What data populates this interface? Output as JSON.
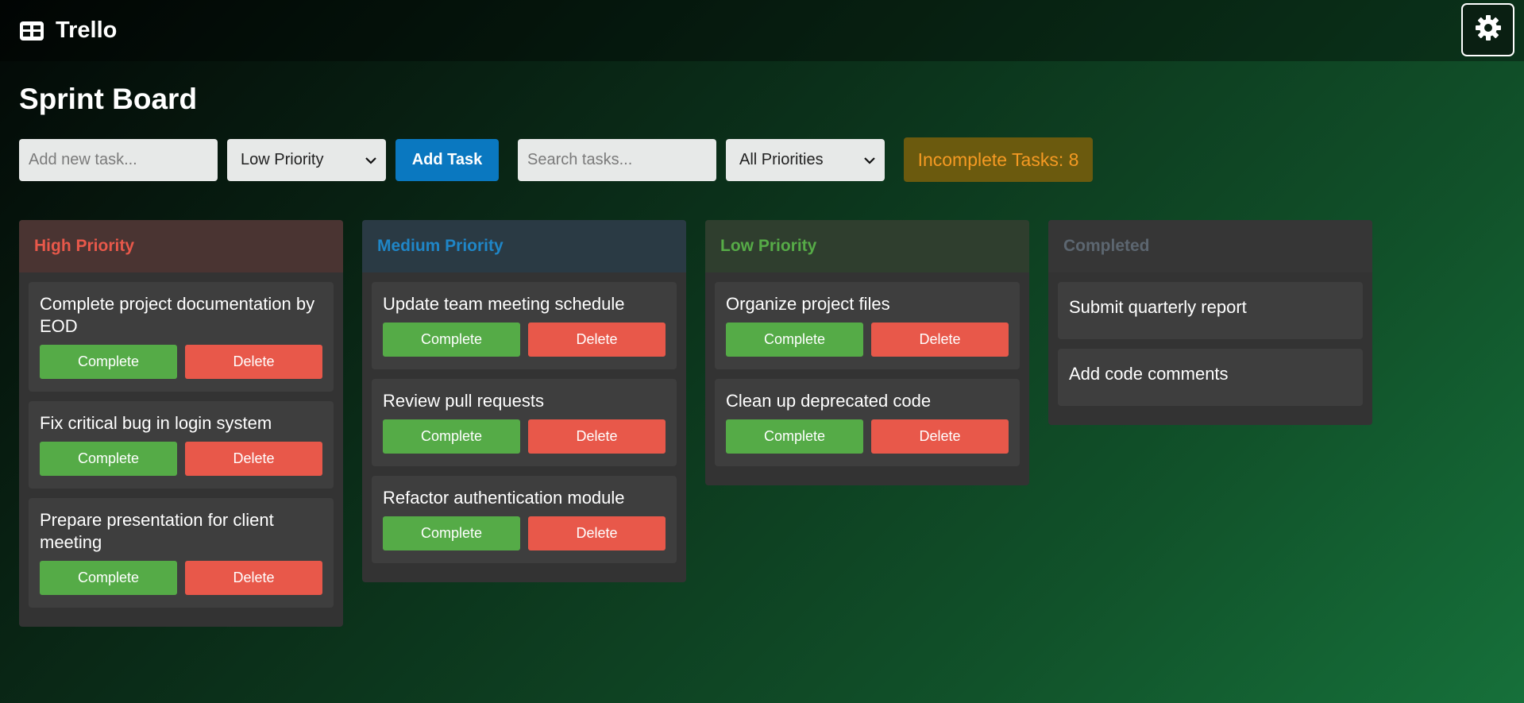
{
  "app": {
    "name": "Trello"
  },
  "page": {
    "title": "Sprint Board"
  },
  "controls": {
    "new_task_placeholder": "Add new task...",
    "priority_select_value": "Low Priority",
    "add_button_label": "Add Task",
    "search_placeholder": "Search tasks...",
    "filter_select_value": "All Priorities",
    "incomplete_label": "Incomplete Tasks: 8"
  },
  "buttons": {
    "complete": "Complete",
    "delete": "Delete"
  },
  "columns": [
    {
      "title": "High Priority",
      "header_color": "#e8584a",
      "header_bg": "#4a3432",
      "tasks": [
        "Complete project documentation by EOD",
        "Fix critical bug in login system",
        "Prepare presentation for client meeting"
      ]
    },
    {
      "title": "Medium Priority",
      "header_color": "#1f86c7",
      "header_bg": "#2a3a44",
      "tasks": [
        "Update team meeting schedule",
        "Review pull requests",
        "Refactor authentication module"
      ]
    },
    {
      "title": "Low Priority",
      "header_color": "#56ab47",
      "header_bg": "#2f3e2e",
      "tasks": [
        "Organize project files",
        "Clean up deprecated code"
      ]
    },
    {
      "title": "Completed",
      "header_color": "#5c6670",
      "header_bg": "#363636",
      "tasks": [
        "Submit quarterly report",
        "Add code comments"
      ]
    }
  ],
  "icons": {
    "brand": "board-icon",
    "settings": "gear-icon",
    "dropdown": "chevron-down-icon"
  }
}
